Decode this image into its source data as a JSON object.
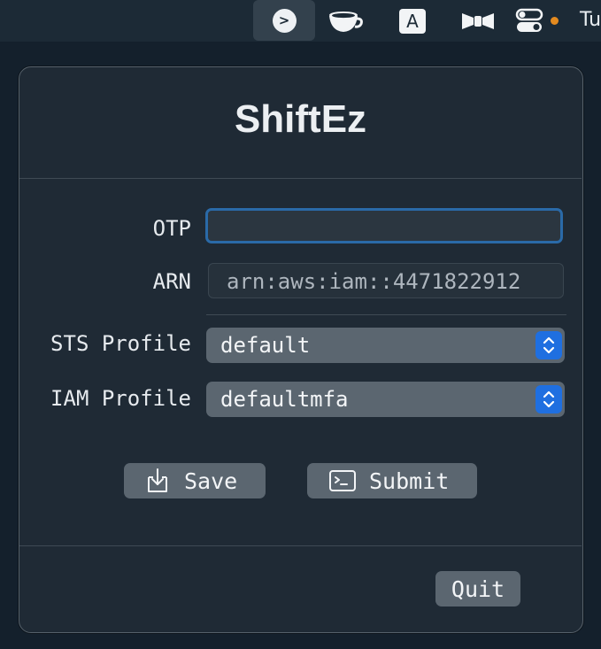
{
  "menubar": {
    "items": [
      {
        "name": "terminal-prompt-icon",
        "glyph": ">"
      },
      {
        "name": "coffee-cup-icon"
      },
      {
        "name": "keyboard-input-a-icon",
        "glyph": "A"
      },
      {
        "name": "bowtie-icon"
      },
      {
        "name": "control-center-toggles-icon"
      }
    ],
    "clock": "Tu"
  },
  "app": {
    "title": "ShiftEz",
    "otp": {
      "label": "OTP",
      "value": ""
    },
    "arn": {
      "label": "ARN",
      "value": "arn:aws:iam::4471822912"
    },
    "sts_profile": {
      "label": "STS Profile",
      "selected": "default"
    },
    "iam_profile": {
      "label": "IAM Profile",
      "selected": "defaultmfa"
    },
    "buttons": {
      "save": "Save",
      "submit": "Submit",
      "quit": "Quit"
    }
  },
  "colors": {
    "accent": "#1f6fe0",
    "focus_ring": "#2a6aa8",
    "status_dot": "#e38a1f",
    "panel_bg": "#1f2a35"
  }
}
